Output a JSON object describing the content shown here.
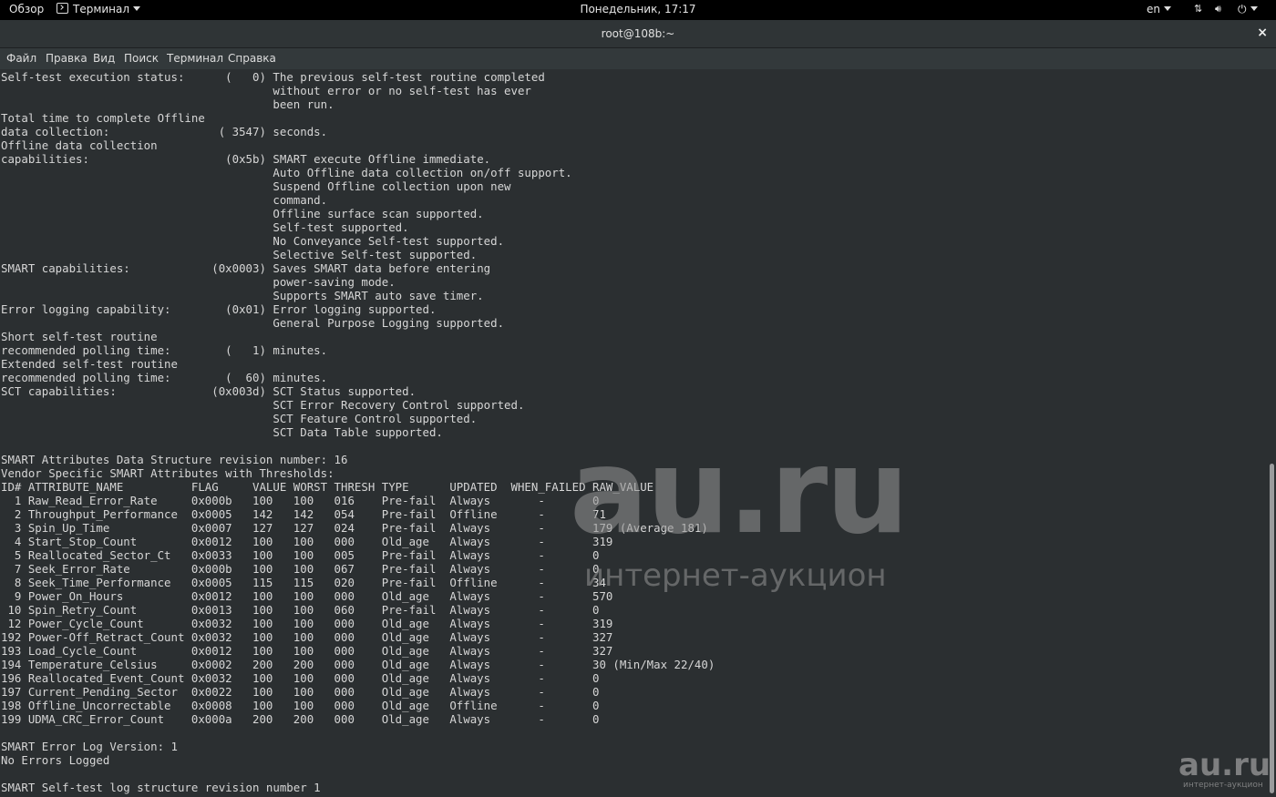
{
  "topbar": {
    "activities": "Обзор",
    "app_menu": "Терминал",
    "clock": "Понедельник, 17:17",
    "language": "en",
    "network_icon": "network-icon",
    "volume_icon": "volume-icon",
    "power_icon": "power-icon"
  },
  "window": {
    "title": "root@108b:~",
    "close_label": "×"
  },
  "menubar": {
    "items": [
      "Файл",
      "Правка",
      "Вид",
      "Поиск",
      "Терминал",
      "Справка"
    ]
  },
  "terminal": {
    "output": "Self-test execution status:      (   0)\tThe previous self-test routine completed\n                                        without error or no self-test has ever \n                                        been run.\nTotal time to complete Offline \ndata collection: \t\t( 3547) seconds.\nOffline data collection\ncapabilities: \t\t\t (0x5b) SMART execute Offline immediate.\n                                        Auto Offline data collection on/off support.\n                                        Suspend Offline collection upon new\n                                        command.\n                                        Offline surface scan supported.\n                                        Self-test supported.\n                                        No Conveyance Self-test supported.\n                                        Selective Self-test supported.\nSMART capabilities:            (0x0003)\tSaves SMART data before entering\n                                        power-saving mode.\n                                        Supports SMART auto save timer.\nError logging capability:        (0x01)\tError logging supported.\n                                        General Purpose Logging supported.\nShort self-test routine \nrecommended polling time: \t (   1) minutes.\nExtended self-test routine\nrecommended polling time: \t (  60) minutes.\nSCT capabilities: \t       (0x003d)\tSCT Status supported.\n                                        SCT Error Recovery Control supported.\n                                        SCT Feature Control supported.\n                                        SCT Data Table supported.\n\nSMART Attributes Data Structure revision number: 16\nVendor Specific SMART Attributes with Thresholds:\nID# ATTRIBUTE_NAME          FLAG     VALUE WORST THRESH TYPE      UPDATED  WHEN_FAILED RAW_VALUE\n  1 Raw_Read_Error_Rate     0x000b   100   100   016    Pre-fail  Always       -       0\n  2 Throughput_Performance  0x0005   142   142   054    Pre-fail  Offline      -       71\n  3 Spin_Up_Time            0x0007   127   127   024    Pre-fail  Always       -       179 (Average 181)\n  4 Start_Stop_Count        0x0012   100   100   000    Old_age   Always       -       319\n  5 Reallocated_Sector_Ct   0x0033   100   100   005    Pre-fail  Always       -       0\n  7 Seek_Error_Rate         0x000b   100   100   067    Pre-fail  Always       -       0\n  8 Seek_Time_Performance   0x0005   115   115   020    Pre-fail  Offline      -       34\n  9 Power_On_Hours          0x0012   100   100   000    Old_age   Always       -       570\n 10 Spin_Retry_Count        0x0013   100   100   060    Pre-fail  Always       -       0\n 12 Power_Cycle_Count       0x0032   100   100   000    Old_age   Always       -       319\n192 Power-Off_Retract_Count 0x0032   100   100   000    Old_age   Always       -       327\n193 Load_Cycle_Count        0x0012   100   100   000    Old_age   Always       -       327\n194 Temperature_Celsius     0x0002   200   200   000    Old_age   Always       -       30 (Min/Max 22/40)\n196 Reallocated_Event_Count 0x0032   100   100   000    Old_age   Always       -       0\n197 Current_Pending_Sector  0x0022   100   100   000    Old_age   Always       -       0\n198 Offline_Uncorrectable   0x0008   100   100   000    Old_age   Offline      -       0\n199 UDMA_CRC_Error_Count    0x000a   200   200   000    Old_age   Always       -       0\n\nSMART Error Log Version: 1\nNo Errors Logged\n\nSMART Self-test log structure revision number 1"
  },
  "watermark": {
    "brand": "au.ru",
    "tagline": "интернет-аукцион",
    "corner_brand": "au.ru",
    "corner_tagline": "интернет-аукцион"
  }
}
